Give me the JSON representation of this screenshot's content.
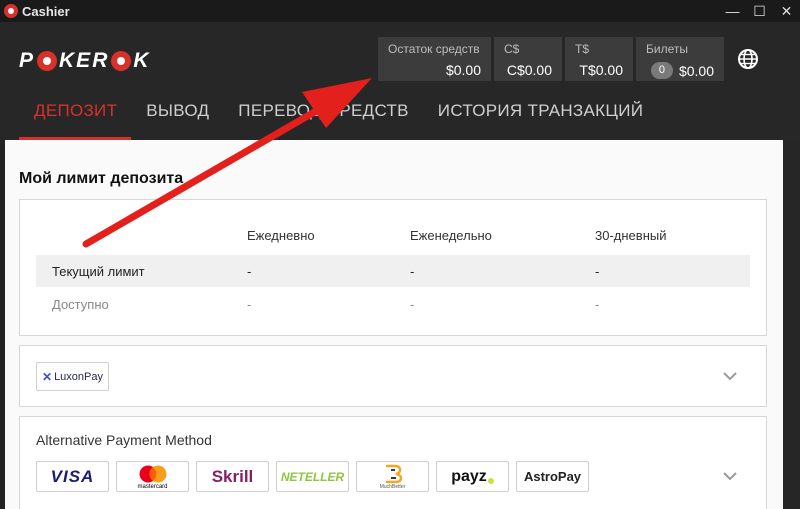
{
  "window": {
    "title": "Cashier",
    "minimize": "—",
    "maximize": "☐",
    "close": "✕"
  },
  "header": {
    "logo_left": "P",
    "logo_mid": "KER",
    "logo_right": "K",
    "balances": [
      {
        "label": "Остаток средств",
        "value": "$0.00"
      },
      {
        "label": "C$",
        "value": "C$0.00"
      },
      {
        "label": "T$",
        "value": "T$0.00"
      },
      {
        "label": "Билеты",
        "count": "0",
        "value": "$0.00"
      }
    ],
    "tabs": [
      "ДЕПОЗИТ",
      "ВЫВОД",
      "ПЕРЕВОД СРЕДСТВ",
      "ИСТОРИЯ ТРАНЗАКЦИЙ"
    ]
  },
  "deposit_limit": {
    "title": "Мой лимит депозита",
    "columns": [
      "Ежедневно",
      "Еженедельно",
      "30-дневный"
    ],
    "rows": [
      {
        "label": "Текущий лимит",
        "values": [
          "-",
          "-",
          "-"
        ]
      },
      {
        "label": "Доступно",
        "values": [
          "-",
          "-",
          "-"
        ]
      }
    ]
  },
  "luxon": {
    "logo_mark": "✕",
    "logo_text": "LuxonPay"
  },
  "alt_payment": {
    "title": "Alternative Payment Method",
    "methods": [
      {
        "name": "VISA",
        "color": "#1a1f71"
      },
      {
        "name": "mastercard",
        "color": "#000000"
      },
      {
        "name": "Skrill",
        "color": "#862165"
      },
      {
        "name": "NETELLER",
        "color": "#8dc63f"
      },
      {
        "name": "MuchBetter",
        "color": "#f5a623"
      },
      {
        "name": "payz",
        "color": "#111111"
      },
      {
        "name": "AstroPay",
        "color": "#222222"
      }
    ]
  },
  "colors": {
    "accent": "#d8312b",
    "header_bg": "#272727",
    "arrow": "#e3201b"
  }
}
